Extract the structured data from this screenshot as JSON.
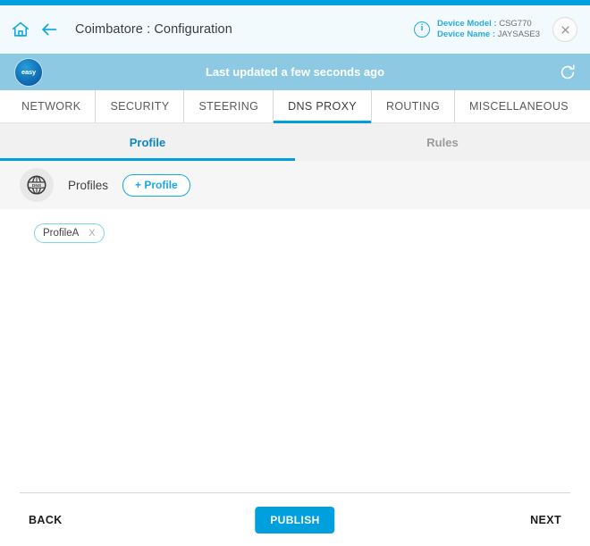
{
  "theme": {
    "accent": "#00a0df",
    "banner_bg": "#8dc9e3",
    "header_bg": "#f2fafd",
    "chip_border": "#7fd3ef",
    "muted_text": "#9b9b9b"
  },
  "header": {
    "home_icon": "home-icon",
    "back_icon": "arrow-left-icon",
    "title": "Coimbatore : Configuration",
    "info_icon": "info-icon",
    "info_glyph": "i",
    "device": {
      "model_label": "Device Model :",
      "model_value": "CSG770",
      "name_label": "Device Name :",
      "name_value": "JAYSASE3"
    },
    "close_icon": "close-icon"
  },
  "banner": {
    "badge_text": "easy",
    "status_text": "Last updated a few seconds ago",
    "refresh_icon": "refresh-icon"
  },
  "main_tabs": [
    {
      "label": "NETWORK",
      "active": false
    },
    {
      "label": "SECURITY",
      "active": false
    },
    {
      "label": "STEERING",
      "active": false
    },
    {
      "label": "DNS PROXY",
      "active": true
    },
    {
      "label": "ROUTING",
      "active": false
    },
    {
      "label": "MISCELLANEOUS",
      "active": false
    }
  ],
  "sub_tabs": [
    {
      "label": "Profile",
      "active": true
    },
    {
      "label": "Rules",
      "active": false
    }
  ],
  "profiles_section": {
    "icon": "dns-globe-icon",
    "icon_text": "DNS",
    "label": "Profiles",
    "add_button": "+ Profile",
    "chips": [
      {
        "label": "ProfileA",
        "remove": "X"
      }
    ]
  },
  "footer": {
    "back_label": "BACK",
    "publish_label": "PUBLISH",
    "next_label": "NEXT"
  }
}
